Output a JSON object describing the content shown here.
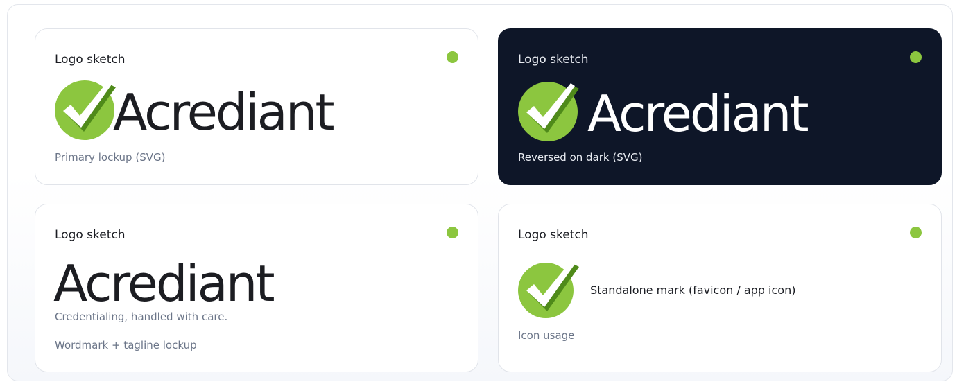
{
  "cards": [
    {
      "label": "Logo sketch",
      "wordmark": "Acrediant",
      "caption": "Primary lockup (SVG)"
    },
    {
      "label": "Logo sketch",
      "wordmark": "Acrediant",
      "caption": "Reversed on dark (SVG)"
    },
    {
      "label": "Logo sketch",
      "wordmark": "Acrediant",
      "tagline": "Credentialing, handled with care.",
      "caption": "Wordmark + tagline lockup"
    },
    {
      "label": "Logo sketch",
      "mark_text": "Standalone mark (favicon / app icon)",
      "caption": "Icon usage"
    }
  ],
  "colors": {
    "brand_green": "#8cc63f",
    "check_shadow": "#4f8a1a",
    "dark_background": "#0e1628",
    "caption_gray": "#6b7588"
  },
  "icons": {
    "mark": "checkmark-circle-icon",
    "status": "green-dot-indicator"
  }
}
